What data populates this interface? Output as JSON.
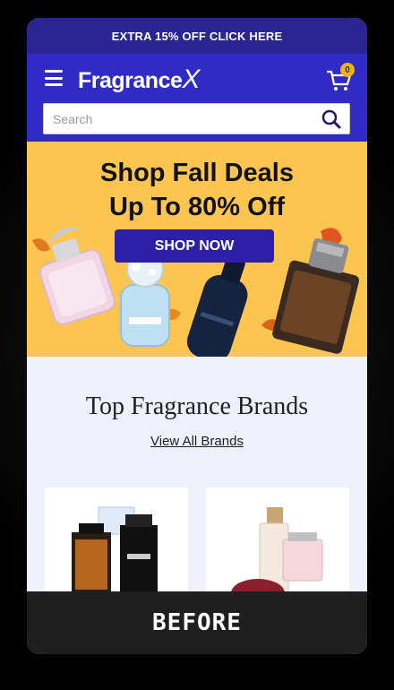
{
  "promo": {
    "text": "EXTRA 15% OFF CLICK HERE"
  },
  "header": {
    "logo_main": "Fragrance",
    "logo_x": "X",
    "cart_count": "0",
    "search_placeholder": "Search"
  },
  "hero": {
    "line1": "Shop Fall Deals",
    "line2": "Up To 80% Off",
    "button_label": "SHOP NOW"
  },
  "brands": {
    "title": "Top Fragrance Brands",
    "link": "View All Brands"
  },
  "overlay": {
    "label": "BEFORE"
  },
  "colors": {
    "promo_bar": "#2d2494",
    "header": "#2f2bc4",
    "hero_bg": "#fcc54f",
    "shop_button": "#2d1fa8",
    "badge": "#f2b705"
  },
  "icons": [
    "hamburger-menu-icon",
    "cart-icon",
    "search-icon"
  ]
}
